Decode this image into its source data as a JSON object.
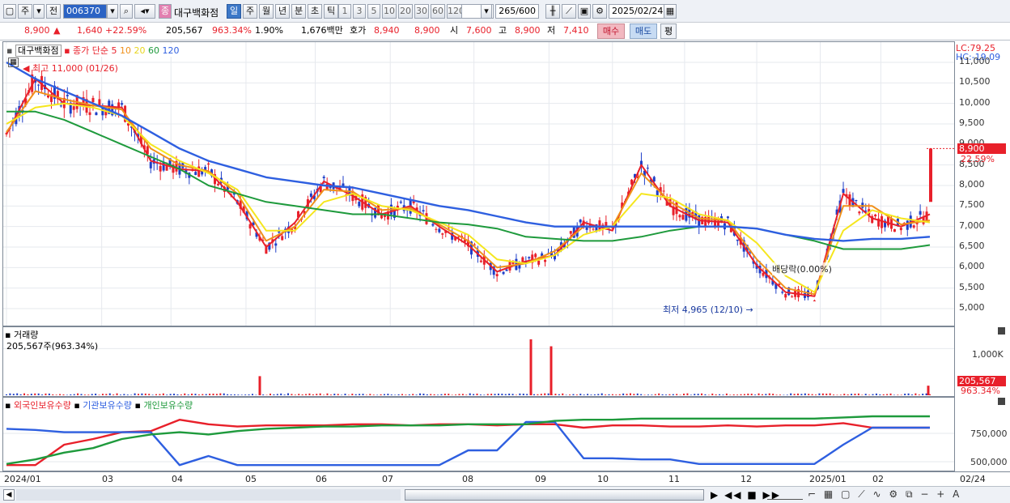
{
  "toolbar": {
    "market": "주",
    "type": "전",
    "code": "006370",
    "stock_badge": "종",
    "stock_name": "대구백화점",
    "periods": [
      "일",
      "주",
      "월",
      "년",
      "분",
      "초",
      "틱"
    ],
    "active_period": "일",
    "intervals": [
      "1",
      "3",
      "5",
      "10",
      "20",
      "30",
      "60",
      "120"
    ],
    "count": "265/600",
    "date": "2025/02/24"
  },
  "quote": {
    "price": "8,900",
    "arrow": "▲",
    "change": "1,640",
    "change_pct": "+22.59%",
    "volume": "205,567",
    "volume_pct": "963.34%",
    "turnover": "1.90%",
    "amount": "1,676백만",
    "bid_label": "호가",
    "bid1": "8,940",
    "bid2": "8,900",
    "open_label": "시",
    "open": "7,600",
    "high_label": "고",
    "high": "8,900",
    "low_label": "저",
    "low": "7,410",
    "buy": "매수",
    "sell": "매도",
    "eval": "평"
  },
  "legend": {
    "name": "대구백화점",
    "indicator": "종가 단순",
    "ma": [
      {
        "label": "5",
        "color": "#e8202a"
      },
      {
        "label": "10",
        "color": "#f0901a"
      },
      {
        "label": "20",
        "color": "#f5e61e"
      },
      {
        "label": "60",
        "color": "#1e9a3c"
      },
      {
        "label": "120",
        "color": "#2e5fe0"
      }
    ]
  },
  "right_axis": {
    "lc": "LC:79.25",
    "hc": "HC:-19.09",
    "price_ticks": [
      "11,000",
      "10,500",
      "10,000",
      "9,500",
      "9,000",
      "8,500",
      "8,000",
      "7,500",
      "7,000",
      "6,500",
      "6,000",
      "5,500",
      "5,000"
    ],
    "current_price": "8,900",
    "current_change": "22.59%",
    "volume_ticks": [
      "1,000K"
    ],
    "current_volume": "205,567",
    "current_volume_pct": "963.34%",
    "holding_ticks": [
      "750,000",
      "500,000"
    ]
  },
  "annotations": {
    "high": "최고 11,000 (01/26)",
    "low": "최저 4,965 (12/10)",
    "dividend": "배당락(0.00%)"
  },
  "volume_panel": {
    "title": "거래량",
    "value": "205,567주(963.34%)"
  },
  "holding_panel": {
    "series": [
      {
        "label": "외국인보유수량",
        "color": "#e8202a"
      },
      {
        "label": "기관보유수량",
        "color": "#2e5fe0"
      },
      {
        "label": "개인보유수량",
        "color": "#1e9a3c"
      }
    ]
  },
  "x_axis": {
    "labels": [
      "2024/01",
      "03",
      "04",
      "05",
      "06",
      "07",
      "08",
      "09",
      "10",
      "11",
      "12",
      "2025/01",
      "02",
      "02/24"
    ]
  },
  "chart_data": {
    "type": "candlestick",
    "ylim": [
      4800,
      11300
    ],
    "price_series": [
      {
        "name": "5",
        "values": [
          9250,
          10600,
          10000,
          9950,
          9900,
          8600,
          8400,
          8350,
          7600,
          6500,
          7100,
          8100,
          7750,
          7300,
          7500,
          7000,
          6550,
          5900,
          6150,
          6300,
          7100,
          6900,
          8500,
          7500,
          7150,
          7100,
          6050,
          5400,
          5300,
          7800,
          7200,
          7000,
          7300
        ]
      },
      {
        "name": "10",
        "values": [
          9300,
          10300,
          10100,
          9950,
          9850,
          8900,
          8500,
          8350,
          7800,
          6650,
          7000,
          7900,
          7850,
          7400,
          7450,
          7050,
          6650,
          6000,
          6100,
          6400,
          7000,
          7000,
          8300,
          7600,
          7200,
          7150,
          6200,
          5500,
          5350,
          7500,
          7500,
          7050,
          7150
        ]
      },
      {
        "name": "20",
        "values": [
          9500,
          9900,
          10000,
          9900,
          9700,
          9000,
          8600,
          8300,
          7900,
          6900,
          6900,
          7600,
          7800,
          7500,
          7400,
          7100,
          6800,
          6200,
          6100,
          6300,
          6800,
          7000,
          7800,
          7700,
          7300,
          7150,
          6600,
          5800,
          5400,
          6900,
          7400,
          7200,
          7100
        ]
      },
      {
        "name": "60",
        "values": [
          9800,
          9800,
          9600,
          9300,
          9000,
          8700,
          8400,
          8000,
          7800,
          7600,
          7500,
          7400,
          7300,
          7300,
          7200,
          7100,
          7050,
          6950,
          6750,
          6700,
          6650,
          6650,
          6750,
          6900,
          7000,
          7000,
          6950,
          6800,
          6650,
          6450,
          6450,
          6450,
          6550
        ]
      },
      {
        "name": "120",
        "values": [
          11000,
          10600,
          10300,
          10000,
          9700,
          9300,
          8900,
          8600,
          8400,
          8200,
          8100,
          8000,
          7950,
          7800,
          7650,
          7500,
          7400,
          7250,
          7100,
          7000,
          7000,
          7000,
          7000,
          7000,
          7000,
          7000,
          6950,
          6800,
          6700,
          6650,
          6700,
          6700,
          6750
        ]
      }
    ],
    "volume_spikes": [
      {
        "date": "2024/05",
        "value": 410000
      },
      {
        "date": "2024/08",
        "value": 1200000
      },
      {
        "date": "2024/09",
        "value": 1050000
      },
      {
        "date": "2025/02/24",
        "value": 205567
      }
    ],
    "holding_series": [
      {
        "name": "외국인보유수량",
        "values": [
          470000,
          470000,
          650000,
          700000,
          760000,
          770000,
          870000,
          830000,
          810000,
          820000,
          820000,
          820000,
          830000,
          830000,
          820000,
          830000,
          830000,
          820000,
          830000,
          830000,
          800000,
          820000,
          820000,
          810000,
          810000,
          820000,
          810000,
          820000,
          820000,
          840000,
          800000,
          800000,
          800000
        ]
      },
      {
        "name": "기관보유수량",
        "values": [
          790000,
          780000,
          760000,
          760000,
          760000,
          760000,
          470000,
          550000,
          470000,
          470000,
          470000,
          470000,
          470000,
          470000,
          470000,
          470000,
          600000,
          600000,
          850000,
          850000,
          530000,
          530000,
          520000,
          520000,
          480000,
          480000,
          480000,
          480000,
          480000,
          650000,
          800000,
          800000,
          800000
        ]
      },
      {
        "name": "개인보유수량",
        "values": [
          480000,
          520000,
          580000,
          620000,
          700000,
          740000,
          760000,
          740000,
          770000,
          790000,
          800000,
          810000,
          810000,
          820000,
          820000,
          820000,
          830000,
          830000,
          830000,
          860000,
          870000,
          870000,
          880000,
          880000,
          880000,
          880000,
          880000,
          880000,
          880000,
          890000,
          900000,
          900000,
          900000
        ]
      }
    ]
  }
}
